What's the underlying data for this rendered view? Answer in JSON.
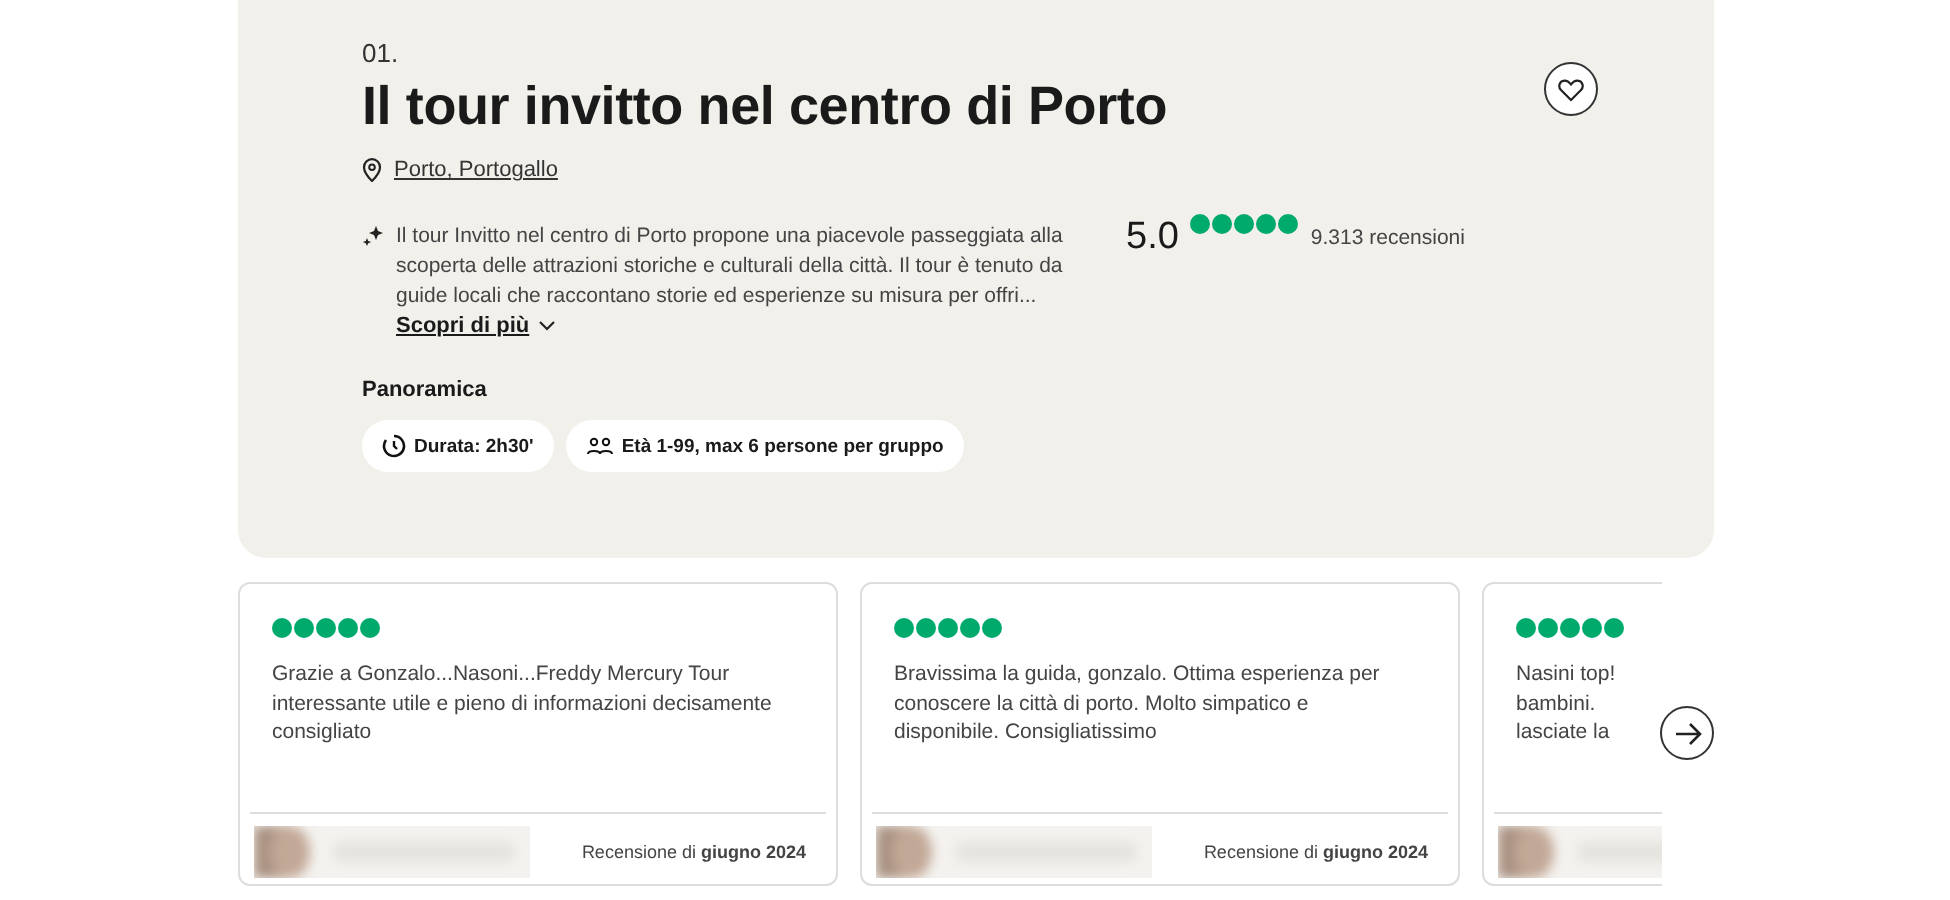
{
  "tour": {
    "index": "01.",
    "title": "Il tour invitto nel centro di Porto",
    "favorite": false,
    "location": "Porto, Portogallo",
    "description": "Il tour Invitto nel centro di Porto propone una piacevole passeggiata alla scoperta delle attrazioni storiche e culturali della città. Il tour è tenuto da guide locali che raccontano storie ed esperienze su misura per offri...",
    "more_link": "Scopri di più",
    "rating": {
      "score": "5.0",
      "stars": 5,
      "count": "9.313 recensioni"
    },
    "overview": {
      "heading": "Panoramica",
      "chips": [
        {
          "kind": "duration",
          "label": "Durata: 2h30'"
        },
        {
          "kind": "group",
          "label": "Età 1-99, max 6 persone per gruppo"
        }
      ]
    }
  },
  "reviews": [
    {
      "stars": 5,
      "text": "Grazie a Gonzalo...Nasoni...Freddy Mercury Tour\ninteressante utile e pieno di informazioni decisamente\nconsigliato",
      "date": "Recensione di **giugno 2024**"
    },
    {
      "stars": 5,
      "text": "Bravissima la guida, gonzalo. Ottima esperienza per\nconoscere la città di porto. Molto simpatico e\ndisponibile. Consigliatissimo",
      "date": "Recensione di **giugno 2024**"
    },
    {
      "stars": 5,
      "text": "Nasini top!\nbambini.\nlasciate la"
    }
  ]
}
